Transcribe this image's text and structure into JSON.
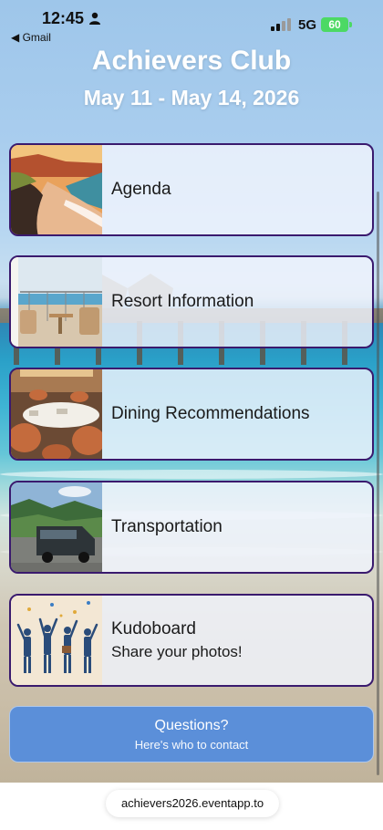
{
  "status_bar": {
    "time": "12:45",
    "back_app": "◀ Gmail",
    "network": "5G",
    "battery": "60"
  },
  "header": {
    "title": "Achievers Club",
    "dates": "May 11 - May 14, 2026"
  },
  "cards": [
    {
      "label": "Agenda",
      "sub": "",
      "icon": "beach-cliff-image"
    },
    {
      "label": "Resort Information",
      "sub": "",
      "icon": "resort-balcony-image"
    },
    {
      "label": "Dining Recommendations",
      "sub": "",
      "icon": "restaurant-image"
    },
    {
      "label": "Transportation",
      "sub": "",
      "icon": "shuttle-van-image"
    },
    {
      "label": "Kudoboard",
      "sub": "Share your photos!",
      "icon": "celebrating-people-image"
    }
  ],
  "questions": {
    "title": "Questions?",
    "subtitle": "Here's who to contact"
  },
  "url_bar": {
    "url": "achievers2026.eventapp.to"
  },
  "colors": {
    "card_border": "#3a1a6e",
    "button": "#5b8fd9",
    "battery": "#4cd964"
  }
}
